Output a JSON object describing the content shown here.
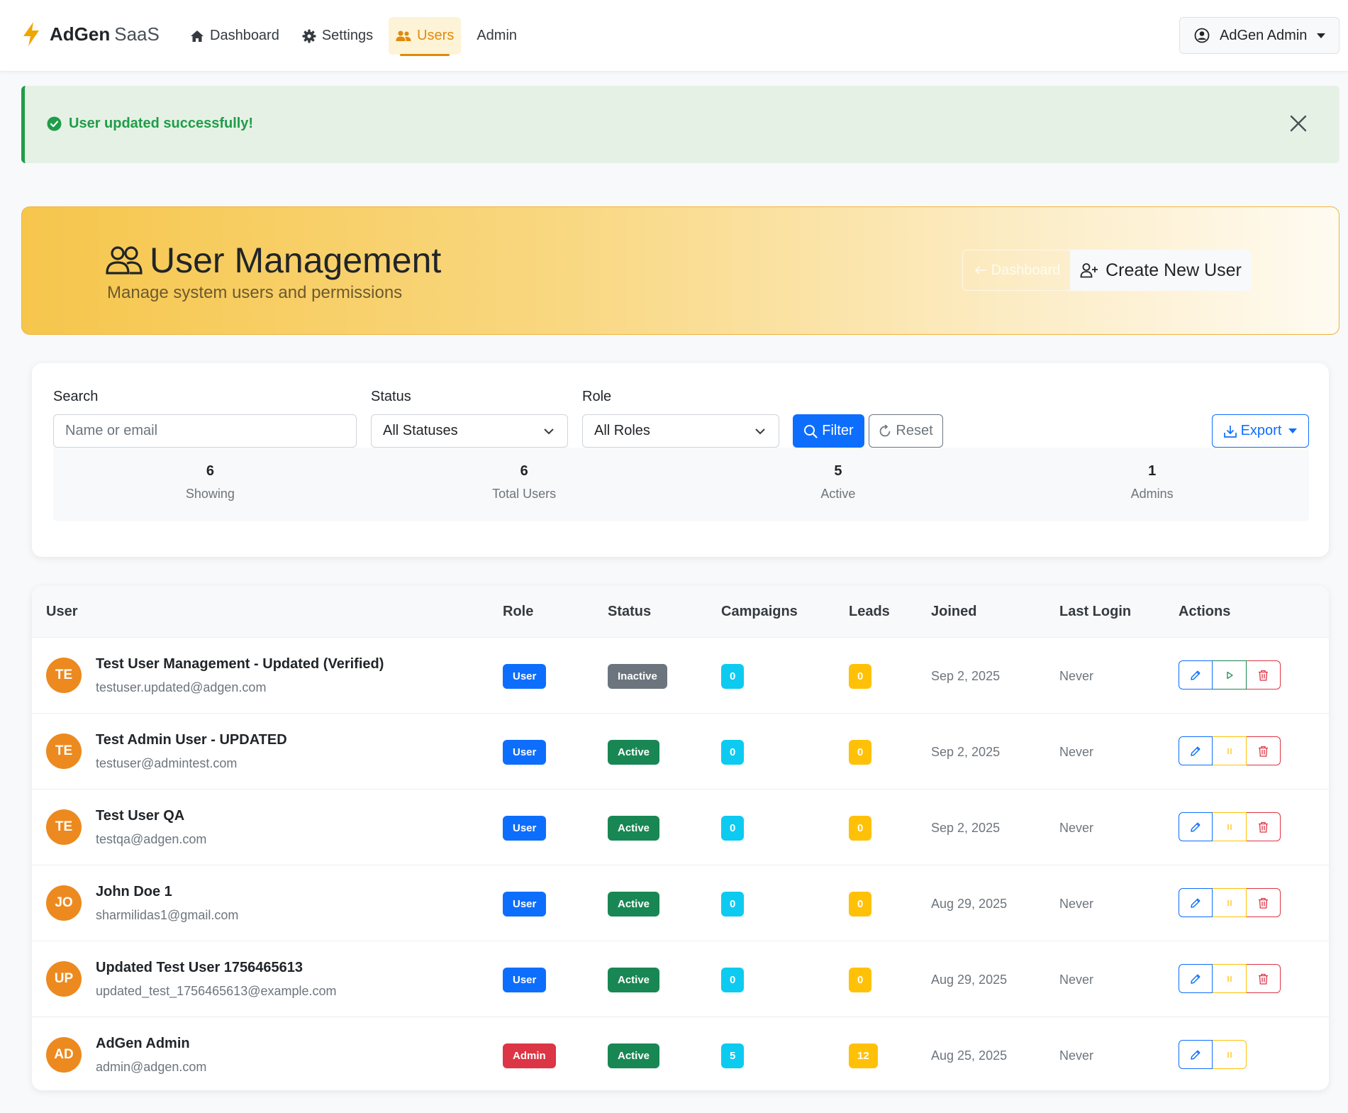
{
  "colors": {
    "brand_bolt": "#f0a500",
    "nav_active": "#e08a0b",
    "success": "#1f9d48",
    "primary": "#0d6efd",
    "badge_user": "#0d6efd",
    "badge_admin": "#dc3545",
    "badge_active": "#198754",
    "badge_inactive": "#6c757d",
    "badge_campaigns": "#0dcaf0",
    "badge_leads": "#ffc107",
    "avatar": "#ec8a1f"
  },
  "brand": {
    "bold": "AdGen",
    "light": "SaaS",
    "icon": "lightning-bolt-icon"
  },
  "nav": {
    "items": [
      {
        "label": "Dashboard",
        "icon": "home-icon"
      },
      {
        "label": "Settings",
        "icon": "gear-icon"
      },
      {
        "label": "Users",
        "icon": "users-icon",
        "active": true
      },
      {
        "label": "Admin",
        "icon": ""
      }
    ],
    "user_menu": {
      "label": "AdGen Admin",
      "icon": "user-circle-icon"
    }
  },
  "alert": {
    "message": "User updated successfully!",
    "icon": "check-circle-icon"
  },
  "hero": {
    "title": "User Management",
    "subtitle": "Manage system users and permissions",
    "back_label": "Dashboard",
    "create_label": "Create New User"
  },
  "filters": {
    "search_label": "Search",
    "search_placeholder": "Name or email",
    "status_label": "Status",
    "status_value": "All Statuses",
    "role_label": "Role",
    "role_value": "All Roles",
    "filter_label": "Filter",
    "reset_label": "Reset",
    "export_label": "Export"
  },
  "stats": [
    {
      "value": "6",
      "label": "Showing"
    },
    {
      "value": "6",
      "label": "Total Users"
    },
    {
      "value": "5",
      "label": "Active"
    },
    {
      "value": "1",
      "label": "Admins"
    }
  ],
  "table": {
    "headers": [
      "User",
      "Role",
      "Status",
      "Campaigns",
      "Leads",
      "Joined",
      "Last Login",
      "Actions"
    ],
    "rows": [
      {
        "initials": "TE",
        "name": "Test User Management - Updated (Verified)",
        "email": "testuser.updated@adgen.com",
        "role": "User",
        "status": "Inactive",
        "campaigns": "0",
        "leads": "0",
        "joined": "Sep 2, 2025",
        "last_login": "Never",
        "toggle": "play",
        "deletable": true
      },
      {
        "initials": "TE",
        "name": "Test Admin User - UPDATED",
        "email": "testuser@admintest.com",
        "role": "User",
        "status": "Active",
        "campaigns": "0",
        "leads": "0",
        "joined": "Sep 2, 2025",
        "last_login": "Never",
        "toggle": "pause",
        "deletable": true
      },
      {
        "initials": "TE",
        "name": "Test User QA",
        "email": "testqa@adgen.com",
        "role": "User",
        "status": "Active",
        "campaigns": "0",
        "leads": "0",
        "joined": "Sep 2, 2025",
        "last_login": "Never",
        "toggle": "pause",
        "deletable": true
      },
      {
        "initials": "JO",
        "name": "John Doe 1",
        "email": "sharmilidas1@gmail.com",
        "role": "User",
        "status": "Active",
        "campaigns": "0",
        "leads": "0",
        "joined": "Aug 29, 2025",
        "last_login": "Never",
        "toggle": "pause",
        "deletable": true
      },
      {
        "initials": "UP",
        "name": "Updated Test User 1756465613",
        "email": "updated_test_1756465613@example.com",
        "role": "User",
        "status": "Active",
        "campaigns": "0",
        "leads": "0",
        "joined": "Aug 29, 2025",
        "last_login": "Never",
        "toggle": "pause",
        "deletable": true
      },
      {
        "initials": "AD",
        "name": "AdGen Admin",
        "email": "admin@adgen.com",
        "role": "Admin",
        "status": "Active",
        "campaigns": "5",
        "leads": "12",
        "joined": "Aug 25, 2025",
        "last_login": "Never",
        "toggle": "pause",
        "deletable": false
      }
    ]
  }
}
